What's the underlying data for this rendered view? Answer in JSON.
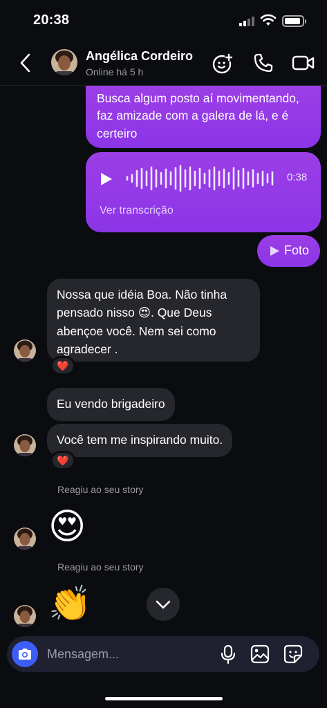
{
  "status_bar": {
    "time": "20:38"
  },
  "header": {
    "contact_name": "Angélica Cordeiro",
    "presence": "Online há 5 h"
  },
  "messages": {
    "out_text_1": "Busca algum posto aí movimentando, faz amizade com a galera de lá, e é certeiro",
    "audio_duration": "0:38",
    "audio_transcript_link": "Ver transcrição",
    "photo_label": "Foto",
    "in_text_1": "Nossa que idéia Boa. Não tinha pensado nisso 😍. Que Deus abençoe você.  Nem sei como agradecer .",
    "in_reaction_1": "❤️",
    "in_text_2": "Eu vendo brigadeiro",
    "in_text_3": "Você tem me inspirando muito.",
    "in_reaction_2": "❤️",
    "story_reply_label_1": "Reagiu ao seu story",
    "story_emoji_1": "😍",
    "story_reply_label_2": "Reagiu ao seu story",
    "story_emoji_2": "👏"
  },
  "composer": {
    "placeholder": "Mensagem..."
  },
  "colors": {
    "background": "#0b0c10",
    "outgoing_bubble": "#9b3ee6",
    "incoming_bubble": "#26272c",
    "camera_button": "#3d5df7"
  },
  "icons": {
    "back": "chevron-left-icon",
    "effects": "face-plus-icon",
    "call": "phone-icon",
    "video": "video-camera-icon",
    "camera": "camera-icon",
    "mic": "microphone-icon",
    "gallery": "image-icon",
    "sticker": "sticker-icon",
    "scroll": "chevron-down-icon"
  }
}
